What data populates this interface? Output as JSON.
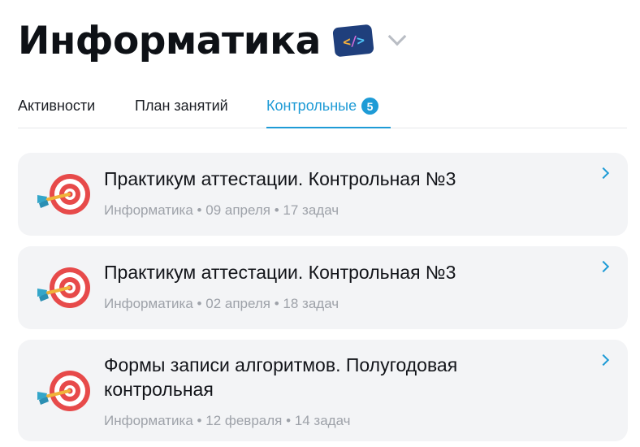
{
  "header": {
    "title": "Информатика",
    "badge_icon": "code-tag-icon",
    "dropdown_icon": "chevron-down-icon"
  },
  "tabs": [
    {
      "label": "Активности",
      "active": false
    },
    {
      "label": "План занятий",
      "active": false
    },
    {
      "label": "Контрольные",
      "active": true,
      "count": "5"
    }
  ],
  "colors": {
    "accent": "#1e9bd6",
    "card_bg": "#f3f4f6",
    "meta_text": "#9ea2a9"
  },
  "tests": [
    {
      "title": "Практикум аттестации. Контрольная №3",
      "subject": "Информатика",
      "date": "09 апреля",
      "tasks": "17 задач",
      "icon": "target-icon"
    },
    {
      "title": "Практикум аттестации. Контрольная №3",
      "subject": "Информатика",
      "date": "02 апреля",
      "tasks": "18 задач",
      "icon": "target-icon"
    },
    {
      "title": "Формы записи алгоритмов. Полугодовая контрольная",
      "subject": "Информатика",
      "date": "12 февраля",
      "tasks": "14 задач",
      "icon": "target-icon"
    }
  ]
}
